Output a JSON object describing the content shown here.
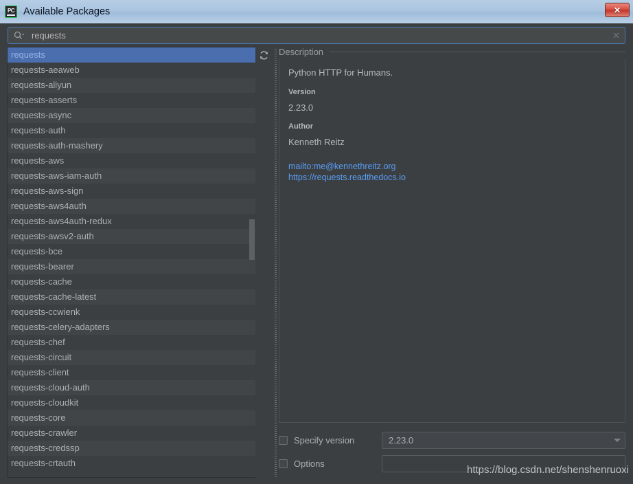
{
  "window": {
    "title": "Available Packages",
    "app_icon": "pycharm-icon",
    "close_label": "✕",
    "titlebar_color": "#abc5e0",
    "bg_color": "#3c3f41"
  },
  "search": {
    "value": "requests",
    "placeholder": "",
    "icon": "search-icon",
    "clear_icon": "clear-icon"
  },
  "package_list": {
    "refresh_icon": "refresh-icon",
    "selected_index": 0,
    "items": [
      "requests",
      "requests-aeaweb",
      "requests-aliyun",
      "requests-asserts",
      "requests-async",
      "requests-auth",
      "requests-auth-mashery",
      "requests-aws",
      "requests-aws-iam-auth",
      "requests-aws-sign",
      "requests-aws4auth",
      "requests-aws4auth-redux",
      "requests-awsv2-auth",
      "requests-bce",
      "requests-bearer",
      "requests-cache",
      "requests-cache-latest",
      "requests-ccwienk",
      "requests-celery-adapters",
      "requests-chef",
      "requests-circuit",
      "requests-client",
      "requests-cloud-auth",
      "requests-cloudkit",
      "requests-core",
      "requests-crawler",
      "requests-credssp",
      "requests-crtauth"
    ]
  },
  "description": {
    "legend": "Description",
    "summary": "Python HTTP for Humans.",
    "version_label": "Version",
    "version_value": "2.23.0",
    "author_label": "Author",
    "author_value": "Kenneth Reitz",
    "links": [
      "mailto:me@kennethreitz.org",
      "https://requests.readthedocs.io"
    ],
    "link_color": "#589df6"
  },
  "form": {
    "specify_version_label": "Specify version",
    "specify_version_checked": false,
    "version_selected": "2.23.0",
    "options_label": "Options",
    "options_checked": false,
    "options_value": ""
  },
  "watermark": {
    "text": "https://blog.csdn.net/shenshenruoxi"
  }
}
